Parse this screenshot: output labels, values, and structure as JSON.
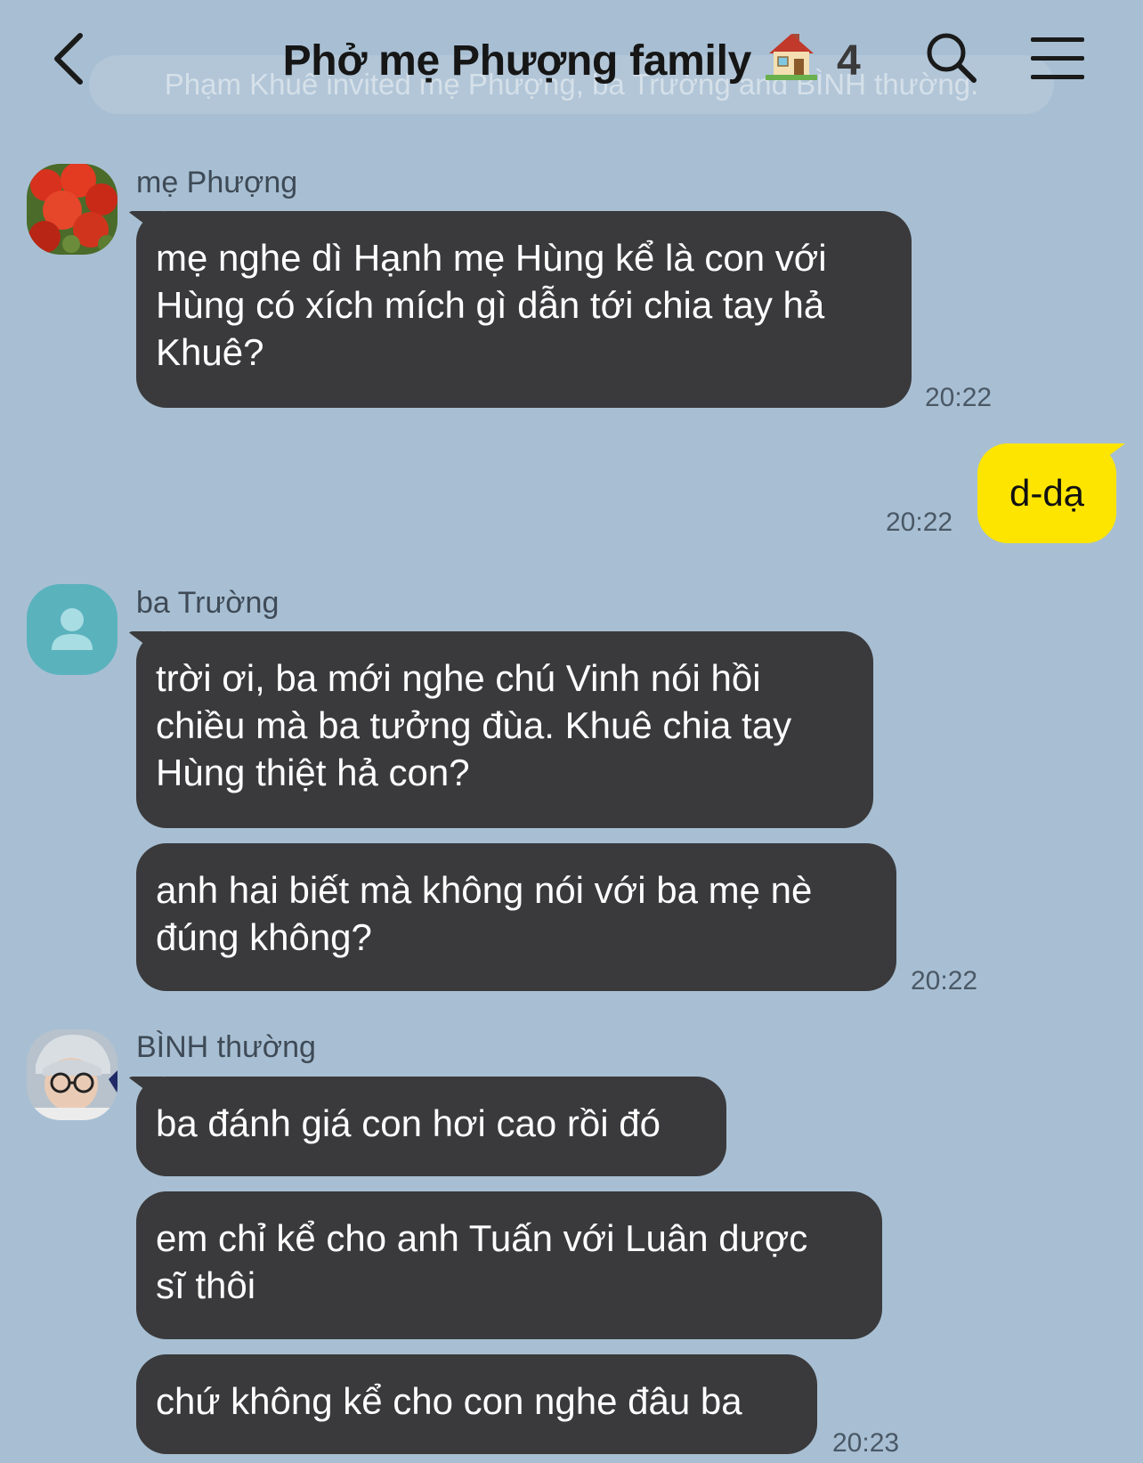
{
  "header": {
    "title": "Phở mẹ Phượng family",
    "member_count": "4",
    "system_notice": "Phạm Khuê invited mẹ Phượng, ba Trường and BÌNH thường."
  },
  "icons": {
    "back": "chevron-left-icon",
    "title_emoji": "house-icon",
    "search": "search-icon",
    "menu": "hamburger-menu-icon"
  },
  "colors": {
    "background": "#a8bfd3",
    "incoming_bubble": "#3a3a3c",
    "outgoing_bubble": "#fee500"
  },
  "messages": {
    "g1": {
      "sender": "mẹ Phượng",
      "texts": [
        "mẹ nghe dì Hạnh mẹ Hùng kể là con với\nHùng có xích mích gì dẫn tới chia tay hả\nKhuê?"
      ],
      "time": "20:22"
    },
    "g2": {
      "texts": [
        "d-dạ"
      ],
      "time": "20:22"
    },
    "g3": {
      "sender": "ba Trường",
      "texts": [
        "trời ơi, ba mới nghe chú Vinh nói hồi\nchiều mà ba tưởng đùa. Khuê chia tay\nHùng thiệt hả con?",
        "anh hai biết mà không nói với ba mẹ nè\nđúng không?"
      ],
      "time": "20:22"
    },
    "g4": {
      "sender": "BÌNH thường",
      "texts": [
        "ba đánh giá con hơi cao rồi đó",
        "em chỉ kể cho anh Tuấn với Luân dược\nsĩ thôi",
        "chứ không kể cho con nghe đâu ba"
      ],
      "time": "20:23"
    }
  }
}
